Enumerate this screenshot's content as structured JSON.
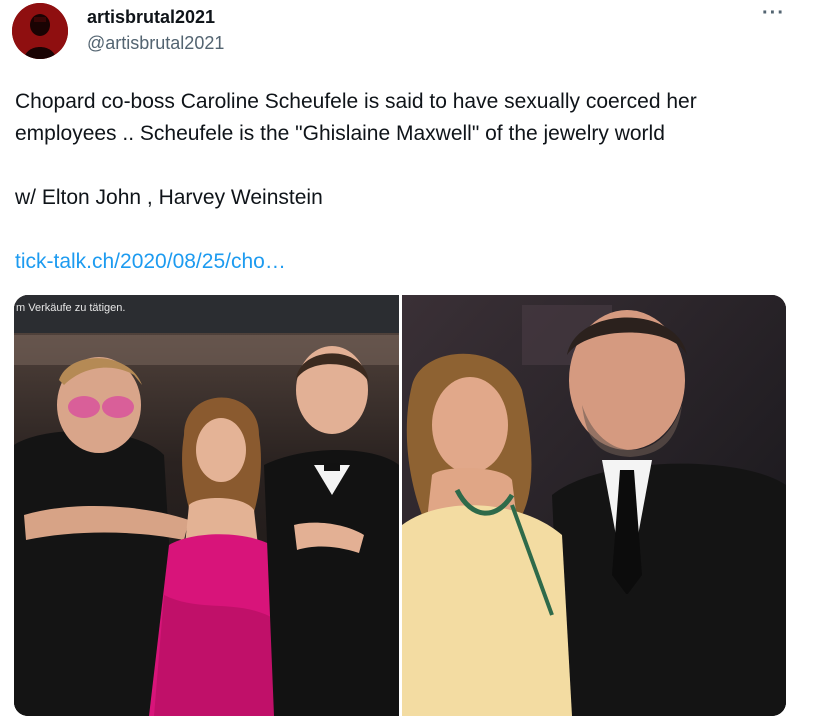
{
  "tweet": {
    "author_name": "artisbrutal2021",
    "author_handle": "@artisbrutal2021",
    "more_icon": "more-horizontal-icon",
    "text_line1": "Chopard co-boss Caroline Scheufele is said to have sexually coerced her",
    "text_line2": "employees .. Scheufele is the \"Ghislaine Maxwell\" of the jewelry world",
    "text_line3": "w/ Elton John , Harvey Weinstein",
    "link_text": "tick-talk.ch/2020/08/25/cho…",
    "colors": {
      "link": "#1d9bf0",
      "secondary": "#536471",
      "pink_dress": "#d8147a"
    }
  },
  "media": {
    "left_caption": "m Verkäufe zu tätigen."
  }
}
